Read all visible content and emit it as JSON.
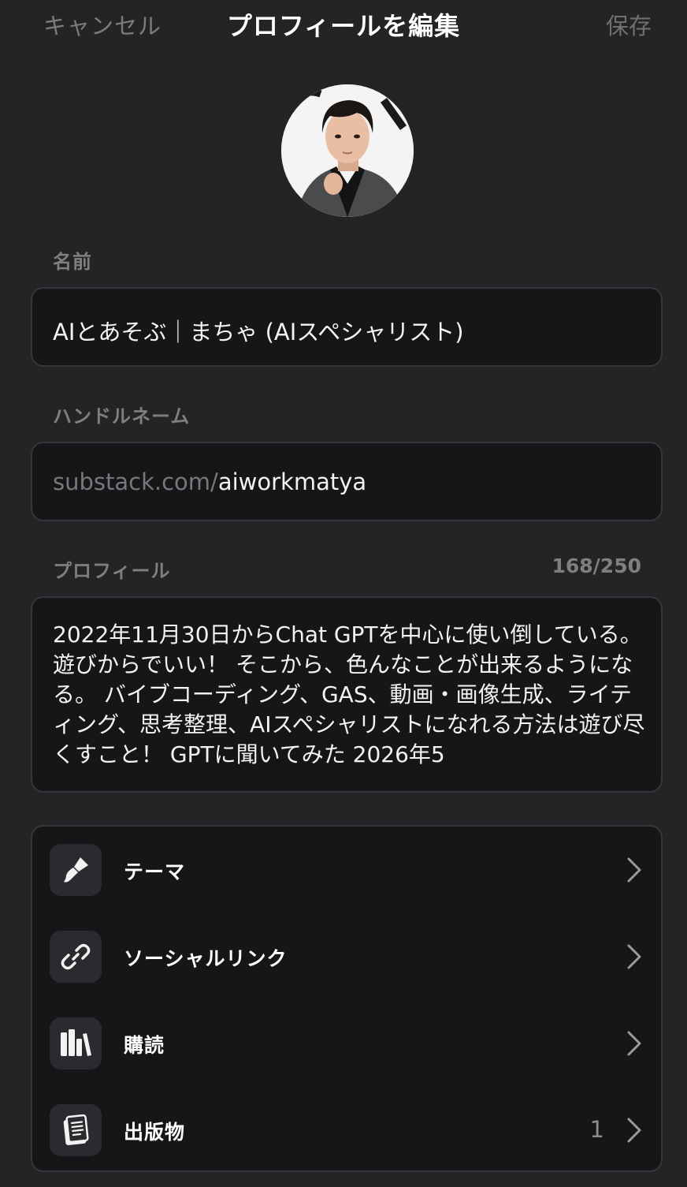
{
  "header": {
    "cancel_label": "キャンセル",
    "title": "プロフィールを編集",
    "save_label": "保存"
  },
  "avatar": {
    "icon": "profile-photo"
  },
  "name_field": {
    "label": "名前",
    "value": "AIとあそぶ｜まちゃ (AIスペシャリスト)"
  },
  "handle_field": {
    "label": "ハンドルネーム",
    "prefix": "substack.com/",
    "value": "aiworkmatya"
  },
  "profile_field": {
    "label": "プロフィール",
    "counter": "168/250",
    "value": "2022年11月30日からChat GPTを中心に使い倒している。 遊びからでいい！ そこから、色んなことが出来るようになる。 バイブコーディング、GAS、動画・画像生成、ライティング、思考整理、AIスペシャリストになれる方法は遊び尽くすこと！ GPTに聞いてみた 2026年5"
  },
  "menu": {
    "items": [
      {
        "label": "テーマ",
        "icon": "paintbrush-icon",
        "count": ""
      },
      {
        "label": "ソーシャルリンク",
        "icon": "link-icon",
        "count": ""
      },
      {
        "label": "購読",
        "icon": "library-icon",
        "count": ""
      },
      {
        "label": "出版物",
        "icon": "document-icon",
        "count": "1"
      }
    ]
  },
  "colors": {
    "background": "#232426",
    "field_background": "#151618",
    "border": "#34363a",
    "muted_text": "#7e7f81"
  }
}
